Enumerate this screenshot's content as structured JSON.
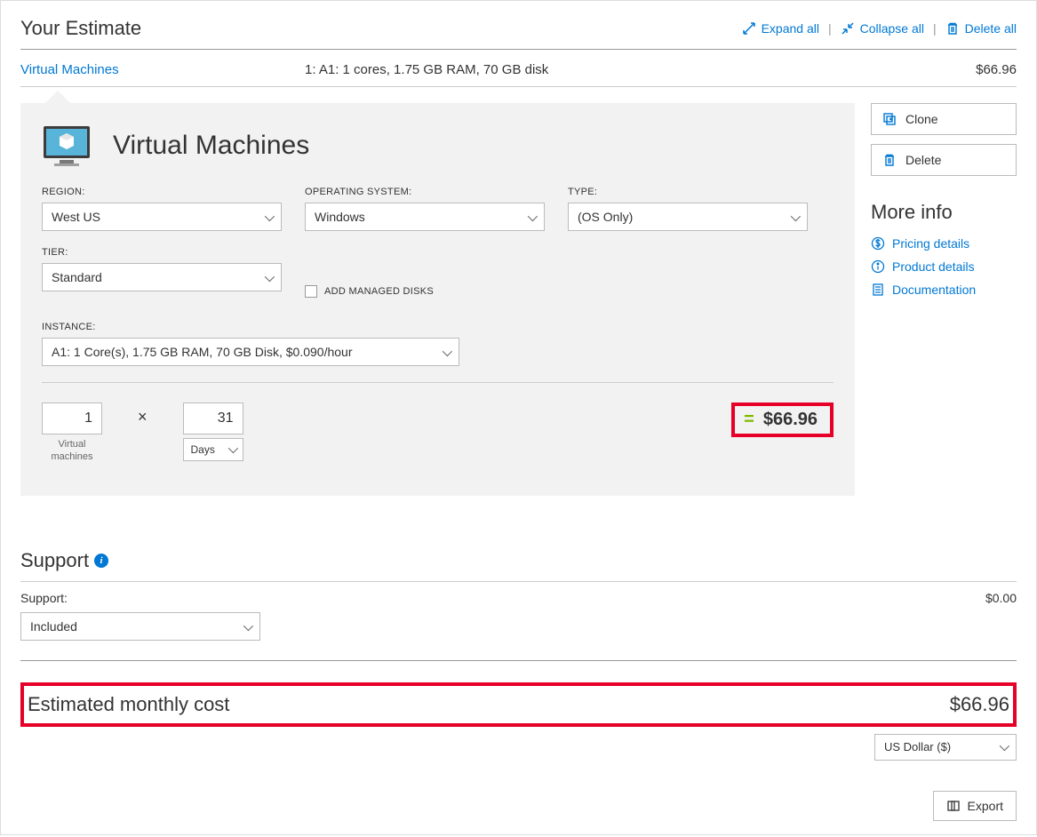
{
  "header": {
    "title": "Your Estimate",
    "expand": "Expand all",
    "collapse": "Collapse all",
    "delete_all": "Delete all"
  },
  "tab": {
    "name": "Virtual Machines",
    "summary": "1: A1: 1 cores, 1.75 GB RAM, 70 GB disk",
    "cost": "$66.96"
  },
  "panel": {
    "title": "Virtual Machines",
    "labels": {
      "region": "REGION:",
      "os": "OPERATING SYSTEM:",
      "type": "TYPE:",
      "tier": "TIER:",
      "managed": "ADD MANAGED DISKS",
      "instance": "INSTANCE:"
    },
    "values": {
      "region": "West US",
      "os": "Windows",
      "type": "(OS Only)",
      "tier": "Standard",
      "instance": "A1: 1 Core(s), 1.75 GB RAM, 70 GB Disk, $0.090/hour"
    },
    "calc": {
      "vm_count": "1",
      "vm_caption": "Virtual\nmachines",
      "days": "31",
      "unit": "Days",
      "equals": "=",
      "result": "$66.96"
    }
  },
  "side": {
    "clone": "Clone",
    "delete": "Delete",
    "more_info": "More info",
    "pricing": "Pricing details",
    "product": "Product details",
    "docs": "Documentation"
  },
  "support": {
    "heading": "Support",
    "label": "Support:",
    "value": "Included",
    "cost": "$0.00"
  },
  "estimate": {
    "label": "Estimated monthly cost",
    "value": "$66.96"
  },
  "footer": {
    "currency": "US Dollar ($)",
    "export": "Export"
  }
}
